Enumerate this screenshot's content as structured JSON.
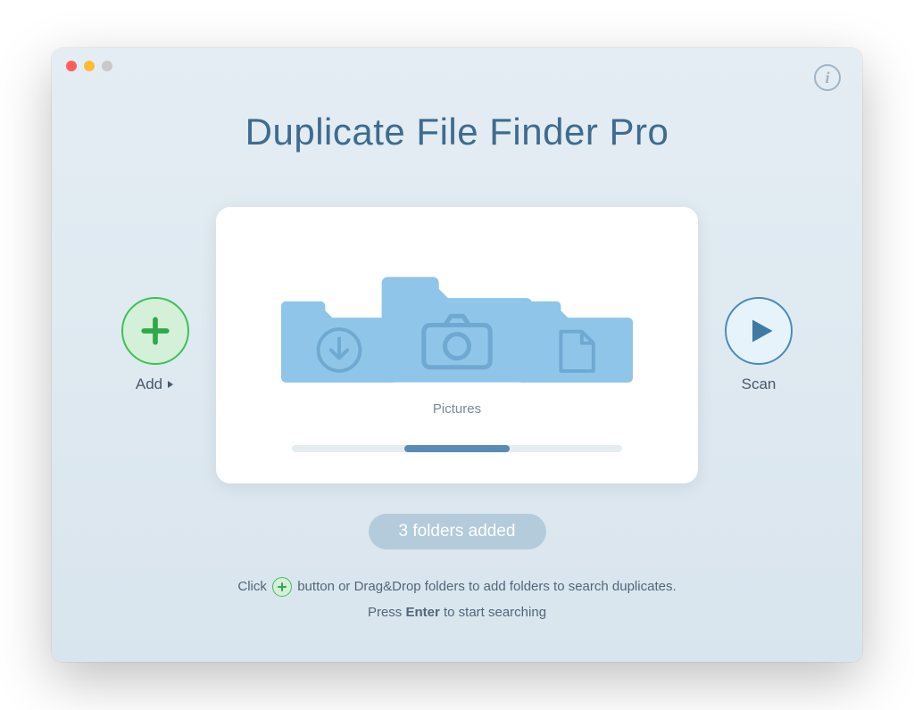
{
  "title": "Duplicate File Finder Pro",
  "add": {
    "label": "Add"
  },
  "scan": {
    "label": "Scan"
  },
  "card": {
    "center_folder_label": "Pictures"
  },
  "status": "3 folders added",
  "hint": {
    "line1_a": "Click ",
    "line1_b": " button or Drag&Drop folders to add folders to search duplicates.",
    "line2_a": "Press ",
    "line2_bold": "Enter",
    "line2_b": " to start searching"
  }
}
